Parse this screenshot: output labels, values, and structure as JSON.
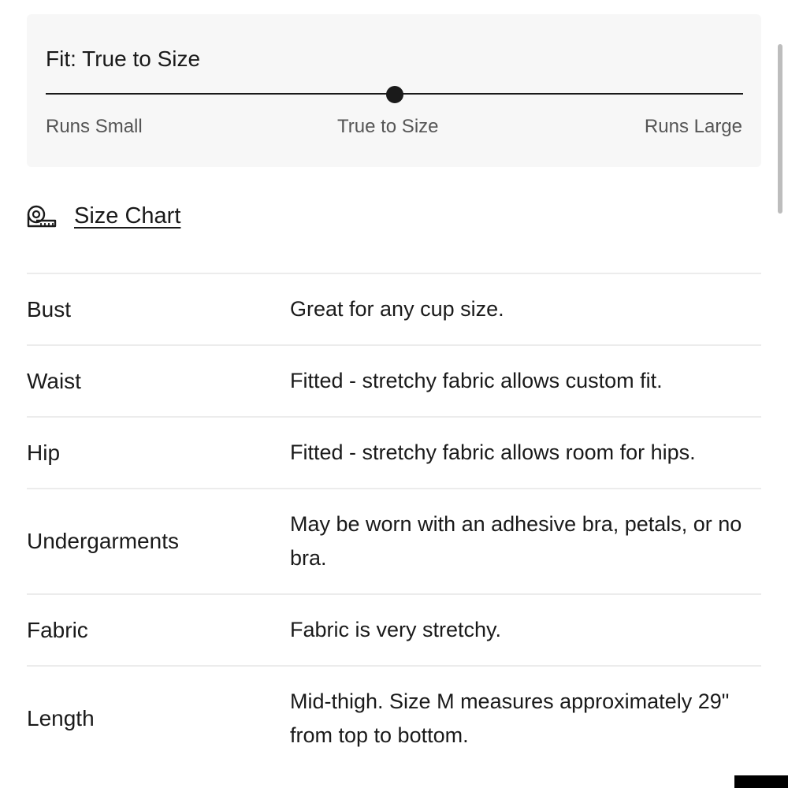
{
  "fit": {
    "title": "Fit: True to Size",
    "slider_value": 0.5,
    "labels": {
      "small": "Runs Small",
      "true": "True to Size",
      "large": "Runs Large"
    }
  },
  "size_chart": {
    "label": "Size Chart",
    "icon": "measuring-tape-icon"
  },
  "specs": [
    {
      "name": "Bust",
      "value": "Great for any cup size."
    },
    {
      "name": "Waist",
      "value": "Fitted - stretchy fabric allows custom fit."
    },
    {
      "name": "Hip",
      "value": "Fitted - stretchy fabric allows room for hips."
    },
    {
      "name": "Undergarments",
      "value": "May be worn with an adhesive bra, petals, or no bra."
    },
    {
      "name": "Fabric",
      "value": "Fabric is very stretchy."
    },
    {
      "name": "Length",
      "value": "Mid-thigh. Size M measures approximately 29\" from top to bottom."
    }
  ],
  "colors": {
    "card_bg": "#f7f7f7",
    "text": "#1a1a1a",
    "muted": "#555555",
    "divider": "#ececec"
  }
}
